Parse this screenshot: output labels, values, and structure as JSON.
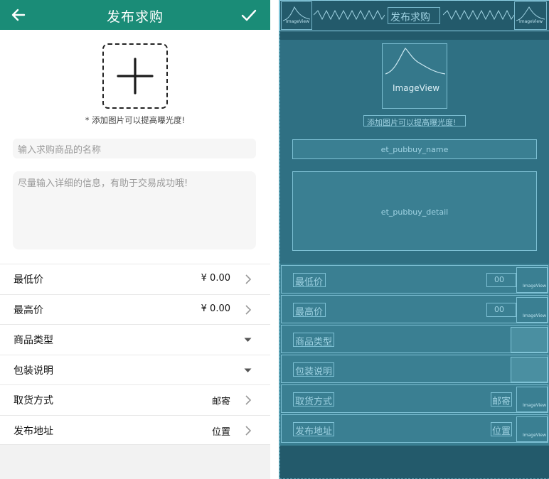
{
  "appbar": {
    "title": "发布求购",
    "back_icon": "arrow-left-icon",
    "confirm_icon": "check-icon",
    "color": "#1a8c77"
  },
  "photo": {
    "add_icon": "plus-icon",
    "tip": "* 添加图片可以提高曝光度!"
  },
  "form": {
    "name_placeholder": "输入求购商品的名称",
    "detail_placeholder": "尽量输入详细的信息，有助于交易成功哦!"
  },
  "rows": [
    {
      "label": "最低价",
      "value": "¥ 0.00",
      "control": "chevron-right-icon"
    },
    {
      "label": "最高价",
      "value": "¥ 0.00",
      "control": "chevron-right-icon"
    },
    {
      "label": "商品类型",
      "value": "",
      "control": "dropdown-triangle-icon"
    },
    {
      "label": "包装说明",
      "value": "",
      "control": "dropdown-triangle-icon"
    },
    {
      "label": "取货方式",
      "value": "邮寄",
      "control": "chevron-right-icon"
    },
    {
      "label": "发布地址",
      "value": "位置",
      "control": "chevron-right-icon"
    }
  ],
  "blueprint": {
    "imageview": "ImageView",
    "tip": "添加图片可以提高曝光度!",
    "title": "发布求购",
    "name_id": "et_pubbuy_name",
    "detail_id": "et_pubbuy_detail",
    "rows": [
      "最低价",
      "最高价",
      "商品类型",
      "包装说明",
      "取货方式",
      "发布地址"
    ],
    "price_value": "00",
    "ship_value": "邮寄",
    "addr_value": "位置"
  }
}
